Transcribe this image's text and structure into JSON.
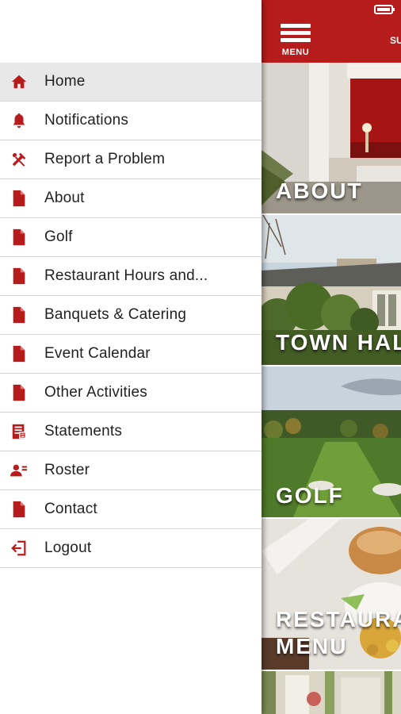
{
  "drawer": {
    "items": [
      {
        "label": "Home",
        "icon": "home-icon"
      },
      {
        "label": "Notifications",
        "icon": "bell-icon"
      },
      {
        "label": "Report a Problem",
        "icon": "tools-icon"
      },
      {
        "label": "About",
        "icon": "document-icon"
      },
      {
        "label": "Golf",
        "icon": "document-icon"
      },
      {
        "label": "Restaurant Hours and...",
        "icon": "document-icon"
      },
      {
        "label": "Banquets & Catering",
        "icon": "document-icon"
      },
      {
        "label": "Event Calendar",
        "icon": "document-icon"
      },
      {
        "label": "Other Activities",
        "icon": "document-icon"
      },
      {
        "label": "Statements",
        "icon": "statement-icon"
      },
      {
        "label": "Roster",
        "icon": "roster-icon"
      },
      {
        "label": "Contact",
        "icon": "document-icon"
      },
      {
        "label": "Logout",
        "icon": "logout-icon"
      }
    ]
  },
  "header": {
    "menu_label": "MENU",
    "partial_text": "SU"
  },
  "tiles": [
    {
      "caption": "ABOUT"
    },
    {
      "caption": "TOWN HAL"
    },
    {
      "caption": "GOLF"
    },
    {
      "caption_line1": "RESTAURA",
      "caption_line2": "MENU"
    }
  ],
  "colors": {
    "accent": "#b71c1c",
    "active_item_bg": "#e8e8e8"
  }
}
